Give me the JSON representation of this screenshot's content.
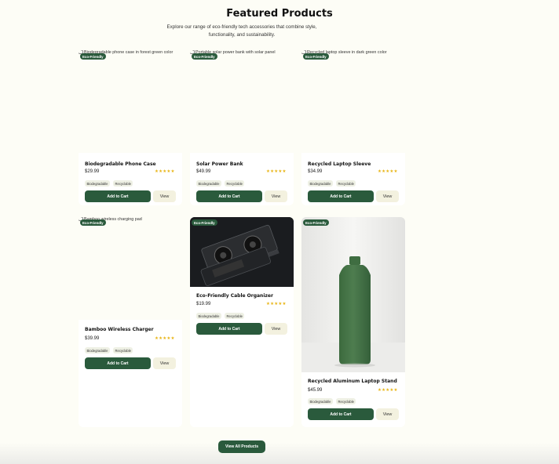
{
  "header": {
    "title": "Featured Products",
    "subtitle": "Explore our range of eco-friendly tech accessories that combine style, functionality, and sustainability."
  },
  "common": {
    "badge": "Eco-Friendly",
    "tag1": "Biodegradable",
    "tag2": "Recyclable",
    "add_to_cart": "Add to Cart",
    "view": "View",
    "stars": "★★★★★"
  },
  "products": [
    {
      "name": "Biodegradable Phone Case",
      "price": "$29.99",
      "alt": "Biodegradable phone case in forest green color"
    },
    {
      "name": "Solar Power Bank",
      "price": "$49.99",
      "alt": "Portable solar power bank with solar panel"
    },
    {
      "name": "Recycled Laptop Sleeve",
      "price": "$34.99",
      "alt": "Recycled laptop sleeve in dark green color"
    },
    {
      "name": "Bamboo Wireless Charger",
      "price": "$39.99",
      "alt": "Bamboo wireless charging pad"
    },
    {
      "name": "Eco-Friendly Cable Organizer",
      "price": "$19.99"
    },
    {
      "name": "Recycled Aluminum Laptop Stand",
      "price": "$45.99"
    }
  ],
  "footer": {
    "view_all": "View All Products"
  },
  "colors": {
    "accent": "#2a5a3c",
    "star": "#e8b517",
    "background": "#fdfdf6"
  }
}
